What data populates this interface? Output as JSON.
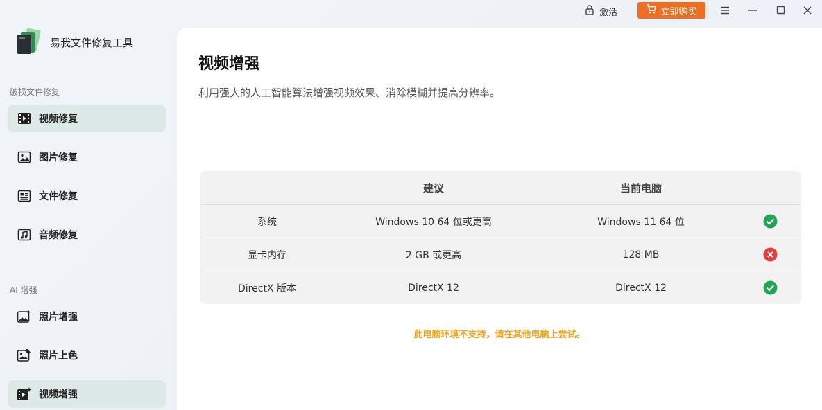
{
  "titlebar": {
    "activate_label": "激活",
    "buy_label": "立即购买",
    "icons": [
      "lock-icon",
      "cart-icon",
      "menu-icon",
      "minimize-icon",
      "maximize-icon",
      "close-icon"
    ]
  },
  "app": {
    "title": "易我文件修复工具"
  },
  "sidebar": {
    "section_repair": "破损文件修复",
    "section_ai": "AI 增强",
    "repair_items": [
      {
        "label": "视频修复",
        "icon": "film-icon",
        "active": true
      },
      {
        "label": "图片修复",
        "icon": "image-icon",
        "active": false
      },
      {
        "label": "文件修复",
        "icon": "document-icon",
        "active": false
      },
      {
        "label": "音频修复",
        "icon": "music-icon",
        "active": false
      }
    ],
    "ai_items": [
      {
        "label": "照片增强",
        "icon": "photo-enhance-icon",
        "active": false
      },
      {
        "label": "照片上色",
        "icon": "photo-colorize-icon",
        "active": false
      },
      {
        "label": "视频增强",
        "icon": "video-enhance-icon",
        "active": true
      }
    ]
  },
  "main": {
    "title": "视频增强",
    "description": "利用强大的人工智能算法增强视频效果、消除模糊并提高分辨率。",
    "table": {
      "headers": [
        "",
        "建议",
        "当前电脑",
        ""
      ],
      "rows": [
        {
          "item": "系统",
          "recommended": "Windows 10 64 位或更高",
          "current": "Windows 11 64 位",
          "status": "ok"
        },
        {
          "item": "显卡内存",
          "recommended": "2 GB 或更高",
          "current": "128 MB",
          "status": "fail"
        },
        {
          "item": "DirectX 版本",
          "recommended": "DirectX 12",
          "current": "DirectX 12",
          "status": "ok"
        }
      ]
    },
    "warning": "此电脑环境不支持，请在其他电脑上尝试。"
  },
  "colors": {
    "accent": "#ec6f23",
    "ok": "#23a455",
    "fail": "#e23c3c",
    "warning": "#f0a41e",
    "active_nav": "#dce9e6"
  }
}
